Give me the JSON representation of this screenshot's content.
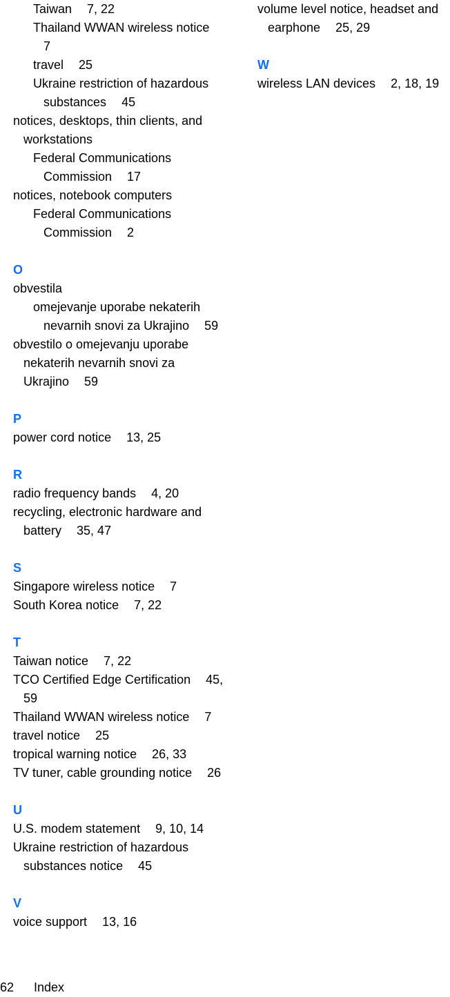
{
  "left_column": [
    {
      "kind": "line",
      "indent": "l1",
      "text": "Taiwan",
      "pages": "7, 22"
    },
    {
      "kind": "line",
      "indent": "l1",
      "text": "Thailand WWAN wireless notice",
      "pages": ""
    },
    {
      "kind": "line",
      "indent": "l1c",
      "text": "7",
      "pages": ""
    },
    {
      "kind": "line",
      "indent": "l1",
      "text": "travel",
      "pages": "25"
    },
    {
      "kind": "line",
      "indent": "l1",
      "text": "Ukraine restriction of hazardous",
      "pages": ""
    },
    {
      "kind": "line",
      "indent": "l1c",
      "text": "substances",
      "pages": "45"
    },
    {
      "kind": "line",
      "indent": "l0",
      "text": "notices, desktops, thin clients, and",
      "pages": ""
    },
    {
      "kind": "line",
      "indent": "l0c",
      "text": "workstations",
      "pages": ""
    },
    {
      "kind": "line",
      "indent": "l1",
      "text": "Federal Communications",
      "pages": ""
    },
    {
      "kind": "line",
      "indent": "l1c",
      "text": "Commission",
      "pages": "17"
    },
    {
      "kind": "line",
      "indent": "l0",
      "text": "notices, notebook computers",
      "pages": ""
    },
    {
      "kind": "line",
      "indent": "l1",
      "text": "Federal Communications",
      "pages": ""
    },
    {
      "kind": "line",
      "indent": "l1c",
      "text": "Commission",
      "pages": "2"
    },
    {
      "kind": "gap"
    },
    {
      "kind": "letter",
      "text": "O"
    },
    {
      "kind": "line",
      "indent": "l0",
      "text": "obvestila",
      "pages": ""
    },
    {
      "kind": "line",
      "indent": "l1",
      "text": "omejevanje uporabe nekaterih",
      "pages": ""
    },
    {
      "kind": "line",
      "indent": "l1c",
      "text": "nevarnih snovi za Ukrajino",
      "pages": "59"
    },
    {
      "kind": "line",
      "indent": "l0",
      "text": "obvestilo o omejevanju uporabe",
      "pages": ""
    },
    {
      "kind": "line",
      "indent": "l0c",
      "text": "nekaterih nevarnih snovi za",
      "pages": ""
    },
    {
      "kind": "line",
      "indent": "l0c",
      "text": "Ukrajino",
      "pages": "59"
    },
    {
      "kind": "gap"
    },
    {
      "kind": "letter",
      "text": "P"
    },
    {
      "kind": "line",
      "indent": "l0",
      "text": "power cord notice",
      "pages": "13, 25"
    },
    {
      "kind": "gap"
    },
    {
      "kind": "letter",
      "text": "R"
    },
    {
      "kind": "line",
      "indent": "l0",
      "text": "radio frequency bands",
      "pages": "4, 20"
    },
    {
      "kind": "line",
      "indent": "l0",
      "text": "recycling, electronic hardware and",
      "pages": ""
    },
    {
      "kind": "line",
      "indent": "l0c",
      "text": "battery",
      "pages": "35, 47"
    },
    {
      "kind": "gap"
    },
    {
      "kind": "letter",
      "text": "S"
    },
    {
      "kind": "line",
      "indent": "l0",
      "text": "Singapore wireless notice",
      "pages": "7"
    },
    {
      "kind": "line",
      "indent": "l0",
      "text": "South Korea notice",
      "pages": "7, 22"
    },
    {
      "kind": "gap"
    },
    {
      "kind": "letter",
      "text": "T"
    },
    {
      "kind": "line",
      "indent": "l0",
      "text": "Taiwan notice",
      "pages": "7, 22"
    },
    {
      "kind": "line",
      "indent": "l0",
      "text": "TCO Certified Edge Certification",
      "pages": "45,"
    },
    {
      "kind": "line",
      "indent": "l0c",
      "text": "59",
      "pages": ""
    },
    {
      "kind": "line",
      "indent": "l0",
      "text": "Thailand WWAN wireless notice",
      "pages": "7"
    },
    {
      "kind": "line",
      "indent": "l0",
      "text": "travel notice",
      "pages": "25"
    },
    {
      "kind": "line",
      "indent": "l0",
      "text": "tropical warning notice",
      "pages": "26, 33"
    },
    {
      "kind": "line",
      "indent": "l0",
      "text": "TV tuner, cable grounding notice",
      "pages": "26"
    },
    {
      "kind": "gap"
    },
    {
      "kind": "letter",
      "text": "U"
    },
    {
      "kind": "line",
      "indent": "l0",
      "text": "U.S. modem statement",
      "pages": "9, 10, 14"
    },
    {
      "kind": "line",
      "indent": "l0",
      "text": "Ukraine restriction of hazardous",
      "pages": ""
    },
    {
      "kind": "line",
      "indent": "l0c",
      "text": "substances notice",
      "pages": "45"
    },
    {
      "kind": "gap"
    },
    {
      "kind": "letter",
      "text": "V"
    },
    {
      "kind": "line",
      "indent": "l0",
      "text": "voice support",
      "pages": "13, 16"
    }
  ],
  "right_column": [
    {
      "kind": "line",
      "indent": "l0",
      "text": "volume level notice, headset and",
      "pages": ""
    },
    {
      "kind": "line",
      "indent": "l0c",
      "text": "earphone",
      "pages": "25, 29"
    },
    {
      "kind": "gap"
    },
    {
      "kind": "letter",
      "text": "W"
    },
    {
      "kind": "line",
      "indent": "l0",
      "text": "wireless LAN devices",
      "pages": "2, 18, 19"
    }
  ],
  "footer": {
    "page_number": "62",
    "section": "Index"
  },
  "colors": {
    "letter_heading": "#0f6fff",
    "text": "#000000"
  }
}
